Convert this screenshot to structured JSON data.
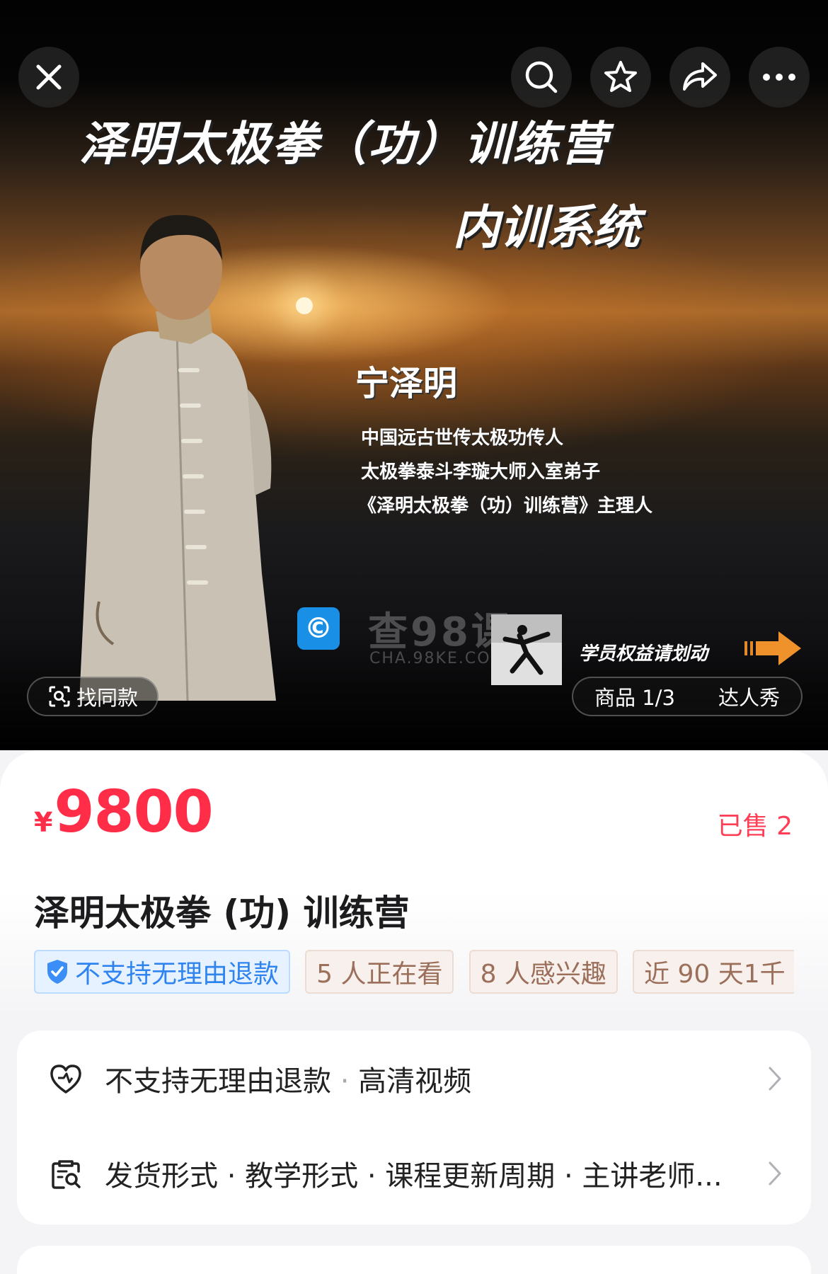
{
  "hero": {
    "title": "泽明太极拳（功）训练营",
    "subtitle": "内训系统",
    "teacher_name": "宁泽明",
    "bio_lines": [
      "中国远古世传太极功传人",
      "太极拳泰斗李璇大师入室弟子",
      "《泽明太极拳（功）训练营》主理人"
    ],
    "watermark_text": "查98课",
    "watermark_url": "CHA.98KE.COM",
    "swipe_hint": "学员权益请划动"
  },
  "overlay": {
    "find_same_label": "找同款",
    "media_tab_products": "商品 1/3",
    "media_tab_showcase": "达人秀"
  },
  "top_bar": {
    "icons": [
      "close-icon",
      "search-icon",
      "star-icon",
      "share-icon",
      "more-icon"
    ]
  },
  "product": {
    "currency": "¥",
    "price": "9800",
    "sold": "已售 2",
    "title": "泽明太极拳 (功) 训练营",
    "tags": [
      {
        "text": "不支持无理由退款",
        "style": "blue"
      },
      {
        "text": "5 人正在看",
        "style": "tan"
      },
      {
        "text": "8 人感兴趣",
        "style": "tan"
      },
      {
        "text": "近 90 天1千",
        "style": "tan"
      }
    ]
  },
  "info_rows": [
    {
      "part1": "不支持无理由退款",
      "sep": " · ",
      "part2": "高清视频"
    },
    {
      "text": "发货形式 · 教学形式 · 课程更新周期 · 主讲老师..."
    }
  ],
  "colors": {
    "price_red": "#ff2d48",
    "tag_blue": "#2f84f0",
    "tag_tan": "#9b6f5a"
  }
}
